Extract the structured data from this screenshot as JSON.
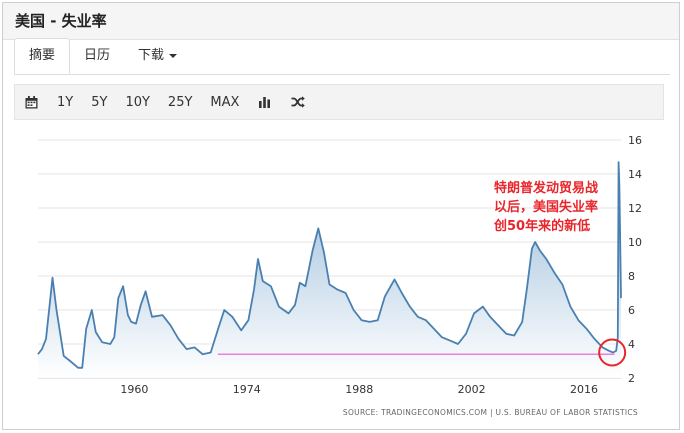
{
  "header": {
    "title": "美国 - 失业率"
  },
  "tabs": [
    {
      "label": "摘要",
      "active": true
    },
    {
      "label": "日历",
      "active": false
    },
    {
      "label": "下载",
      "active": false,
      "dropdown": true
    }
  ],
  "toolbar": {
    "icons": [
      "calendar-icon",
      "bar-chart-icon",
      "shuffle-icon"
    ],
    "ranges": [
      "1Y",
      "5Y",
      "10Y",
      "25Y",
      "MAX"
    ]
  },
  "annotation": {
    "lines": [
      "特朗普发动贸易战",
      "以后，美国失业率",
      "创50年来的新低"
    ],
    "color": "#e8262b"
  },
  "source": "SOURCE: TRADINGECONOMICS.COM  |  U.S. BUREAU OF LABOR STATISTICS",
  "colors": {
    "line": "#4a80b0",
    "area_top": "#8fb5d6",
    "area_bottom": "#ffffff",
    "reference_line": "#e05ad4",
    "marker": "#e8262b"
  },
  "chart_data": {
    "type": "area",
    "title": "",
    "xlabel": "",
    "ylabel": "",
    "x_ticks": [
      "1960",
      "1974",
      "1988",
      "2002",
      "2016"
    ],
    "y_ticks": [
      "2",
      "4",
      "6",
      "8",
      "10",
      "12",
      "14",
      "16"
    ],
    "xlim": [
      1948,
      2020.6
    ],
    "ylim": [
      2,
      16
    ],
    "grid": true,
    "y_axis_position": "right",
    "series": [
      {
        "points": [
          [
            1948.0,
            3.4
          ],
          [
            1948.5,
            3.7
          ],
          [
            1949.0,
            4.3
          ],
          [
            1949.5,
            6.5
          ],
          [
            1949.8,
            7.9
          ],
          [
            1950.3,
            6.0
          ],
          [
            1950.8,
            4.5
          ],
          [
            1951.2,
            3.3
          ],
          [
            1952.0,
            3.0
          ],
          [
            1953.0,
            2.6
          ],
          [
            1953.5,
            2.6
          ],
          [
            1954.0,
            4.9
          ],
          [
            1954.7,
            6.0
          ],
          [
            1955.2,
            4.7
          ],
          [
            1956.0,
            4.1
          ],
          [
            1957.0,
            4.0
          ],
          [
            1957.5,
            4.4
          ],
          [
            1958.0,
            6.7
          ],
          [
            1958.6,
            7.4
          ],
          [
            1959.2,
            5.7
          ],
          [
            1959.6,
            5.3
          ],
          [
            1960.2,
            5.2
          ],
          [
            1960.8,
            6.3
          ],
          [
            1961.4,
            7.1
          ],
          [
            1962.2,
            5.6
          ],
          [
            1963.5,
            5.7
          ],
          [
            1964.5,
            5.1
          ],
          [
            1965.5,
            4.3
          ],
          [
            1966.5,
            3.7
          ],
          [
            1967.5,
            3.8
          ],
          [
            1968.5,
            3.4
          ],
          [
            1969.5,
            3.5
          ],
          [
            1970.5,
            5.0
          ],
          [
            1971.2,
            6.0
          ],
          [
            1972.2,
            5.6
          ],
          [
            1973.3,
            4.8
          ],
          [
            1974.2,
            5.4
          ],
          [
            1974.9,
            7.2
          ],
          [
            1975.4,
            9.0
          ],
          [
            1976.0,
            7.7
          ],
          [
            1977.0,
            7.4
          ],
          [
            1978.0,
            6.2
          ],
          [
            1979.2,
            5.8
          ],
          [
            1980.0,
            6.3
          ],
          [
            1980.6,
            7.6
          ],
          [
            1981.3,
            7.4
          ],
          [
            1982.2,
            9.5
          ],
          [
            1982.9,
            10.8
          ],
          [
            1983.6,
            9.4
          ],
          [
            1984.3,
            7.5
          ],
          [
            1985.3,
            7.2
          ],
          [
            1986.3,
            7.0
          ],
          [
            1987.3,
            6.0
          ],
          [
            1988.3,
            5.4
          ],
          [
            1989.3,
            5.3
          ],
          [
            1990.3,
            5.4
          ],
          [
            1991.2,
            6.8
          ],
          [
            1992.4,
            7.8
          ],
          [
            1993.3,
            7.0
          ],
          [
            1994.3,
            6.2
          ],
          [
            1995.3,
            5.6
          ],
          [
            1996.3,
            5.4
          ],
          [
            1997.3,
            4.9
          ],
          [
            1998.3,
            4.4
          ],
          [
            1999.3,
            4.2
          ],
          [
            2000.3,
            4.0
          ],
          [
            2001.3,
            4.6
          ],
          [
            2002.3,
            5.8
          ],
          [
            2003.4,
            6.2
          ],
          [
            2004.3,
            5.6
          ],
          [
            2005.3,
            5.1
          ],
          [
            2006.3,
            4.6
          ],
          [
            2007.3,
            4.5
          ],
          [
            2008.3,
            5.3
          ],
          [
            2008.9,
            7.3
          ],
          [
            2009.5,
            9.6
          ],
          [
            2009.9,
            10.0
          ],
          [
            2010.5,
            9.5
          ],
          [
            2011.3,
            9.0
          ],
          [
            2012.3,
            8.2
          ],
          [
            2013.3,
            7.5
          ],
          [
            2014.3,
            6.2
          ],
          [
            2015.3,
            5.4
          ],
          [
            2016.3,
            4.9
          ],
          [
            2017.3,
            4.3
          ],
          [
            2018.3,
            3.8
          ],
          [
            2019.1,
            3.6
          ],
          [
            2019.6,
            3.5
          ],
          [
            2020.0,
            3.6
          ],
          [
            2020.2,
            4.4
          ],
          [
            2020.3,
            14.7
          ],
          [
            2020.4,
            13.2
          ],
          [
            2020.5,
            10.0
          ],
          [
            2020.6,
            6.7
          ]
        ]
      }
    ]
  }
}
